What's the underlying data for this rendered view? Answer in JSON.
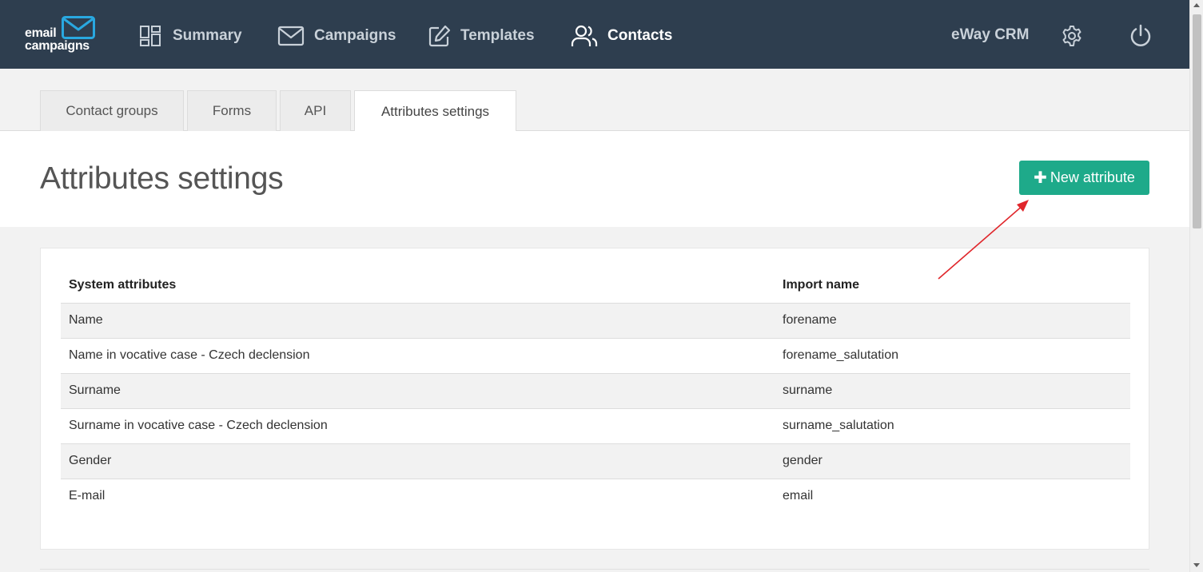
{
  "logo": {
    "line1": "email",
    "line2": "campaigns"
  },
  "nav": {
    "summary": "Summary",
    "campaigns": "Campaigns",
    "templates": "Templates",
    "contacts": "Contacts",
    "crm": "eWay CRM",
    "active": "contacts"
  },
  "tabs": [
    {
      "label": "Contact groups"
    },
    {
      "label": "Forms"
    },
    {
      "label": "API"
    },
    {
      "label": "Attributes settings",
      "active": true
    }
  ],
  "page": {
    "title": "Attributes settings",
    "new_button": "New attribute"
  },
  "table": {
    "headers": [
      "System attributes",
      "Import name"
    ],
    "rows": [
      [
        "Name",
        "forename"
      ],
      [
        "Name in vocative case - Czech declension",
        "forename_salutation"
      ],
      [
        "Surname",
        "surname"
      ],
      [
        "Surname in vocative case - Czech declension",
        "surname_salutation"
      ],
      [
        "Gender",
        "gender"
      ],
      [
        "E-mail",
        "email"
      ]
    ]
  },
  "colors": {
    "topbar": "#2e3e4f",
    "accent": "#1eaa8a",
    "logo_blue": "#29a8e0",
    "annotation_arrow": "#e0262b"
  },
  "icons": [
    "email-logo-icon",
    "summary-grid-icon",
    "envelope-icon",
    "edit-pencil-icon",
    "users-icon",
    "gear-icon",
    "power-icon",
    "plus-icon"
  ]
}
